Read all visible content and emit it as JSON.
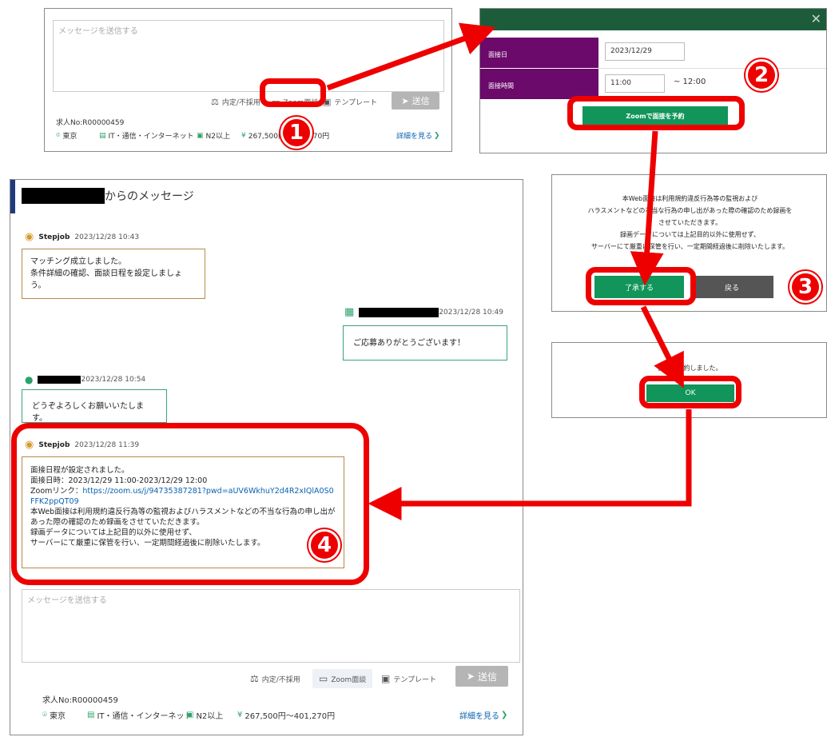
{
  "top_panel": {
    "placeholder": "メッセージを送信する",
    "toolbar": {
      "decision": "内定/不採用",
      "zoom": "Zoom面談",
      "template": "テンプレート",
      "send": "送信"
    },
    "job_no": "求人No:R00000459",
    "tags": {
      "location": "東京",
      "industry": "IT・通信・インターネット",
      "level": "N2以上",
      "salary": "267,500円〜401,270円"
    },
    "detail_link": "詳細を見る"
  },
  "interview_dialog": {
    "date_label": "面接日",
    "date_value": "2023/12/29",
    "time_label": "面接時間",
    "time_start": "11:00",
    "time_end": "~ 12:00",
    "reserve_button": "Zoomで面接を予約"
  },
  "consent_dialog": {
    "lines": [
      "本Web面接は利用規約違反行為等の監視および",
      "ハラスメントなどの不当な行為の申し出があった際の確認のため録画を",
      "させていただきます。",
      "録画データについては上記目的以外に使用せず、",
      "サーバーにて厳重に保管を行い、一定期間経過後に削除いたします。"
    ],
    "accept_button": "了承する",
    "back_button": "戻る"
  },
  "done_dialog": {
    "message": "面接を予約しました。",
    "ok_button": "OK"
  },
  "chat": {
    "header_suffix": "からのメッセージ",
    "messages": [
      {
        "sender": "Stepjob",
        "time": "2023/12/28 10:43",
        "text": "マッチング成立しました。\n条件詳細の確認、面談日程を設定しましょう。"
      },
      {
        "sender": "",
        "time": "2023/12/28 10:49",
        "text": "ご応募ありがとうございます！"
      },
      {
        "sender": "",
        "time": "2023/12/28 10:54",
        "text": "どうぞよろしくお願いいたします。"
      },
      {
        "sender": "Stepjob",
        "time": "2023/12/28 11:39"
      }
    ],
    "final_message": {
      "line1": "面接日程が設定されました。",
      "line2": "面接日時：2023/12/29 11:00-2023/12/29 12:00",
      "link_prefix": "Zoomリンク：",
      "link": "https://zoom.us/j/94735387281?pwd=aUV6WkhuY2d4R2xIQlA0S0FFK2ppQT09",
      "line4": "本Web面接は利用規約違反行為等の監視およびハラスメントなどの不当な行為の申し出があった際の確認のため録画をさせていただきます。",
      "line5": "録画データについては上記目的以外に使用せず、",
      "line6": "サーバーにて厳重に保管を行い、一定期間経過後に削除いたします。"
    },
    "composer": {
      "placeholder": "メッセージを送信する",
      "decision": "内定/不採用",
      "zoom": "Zoom面談",
      "template": "テンプレート",
      "send": "送信",
      "job_no": "求人No:R00000459",
      "location": "東京",
      "industry": "IT・通信・インターネット",
      "level": "N2以上",
      "salary": "267,500円〜401,270円",
      "detail_link": "詳細を見る"
    }
  },
  "badges": [
    "1",
    "2",
    "3",
    "4"
  ],
  "colors": {
    "accent_red": "#ee0000",
    "dialog_green": "#1d5c3a",
    "button_green": "#11955a",
    "label_purple": "#6b0a6b",
    "link_blue": "#0a62b0"
  }
}
